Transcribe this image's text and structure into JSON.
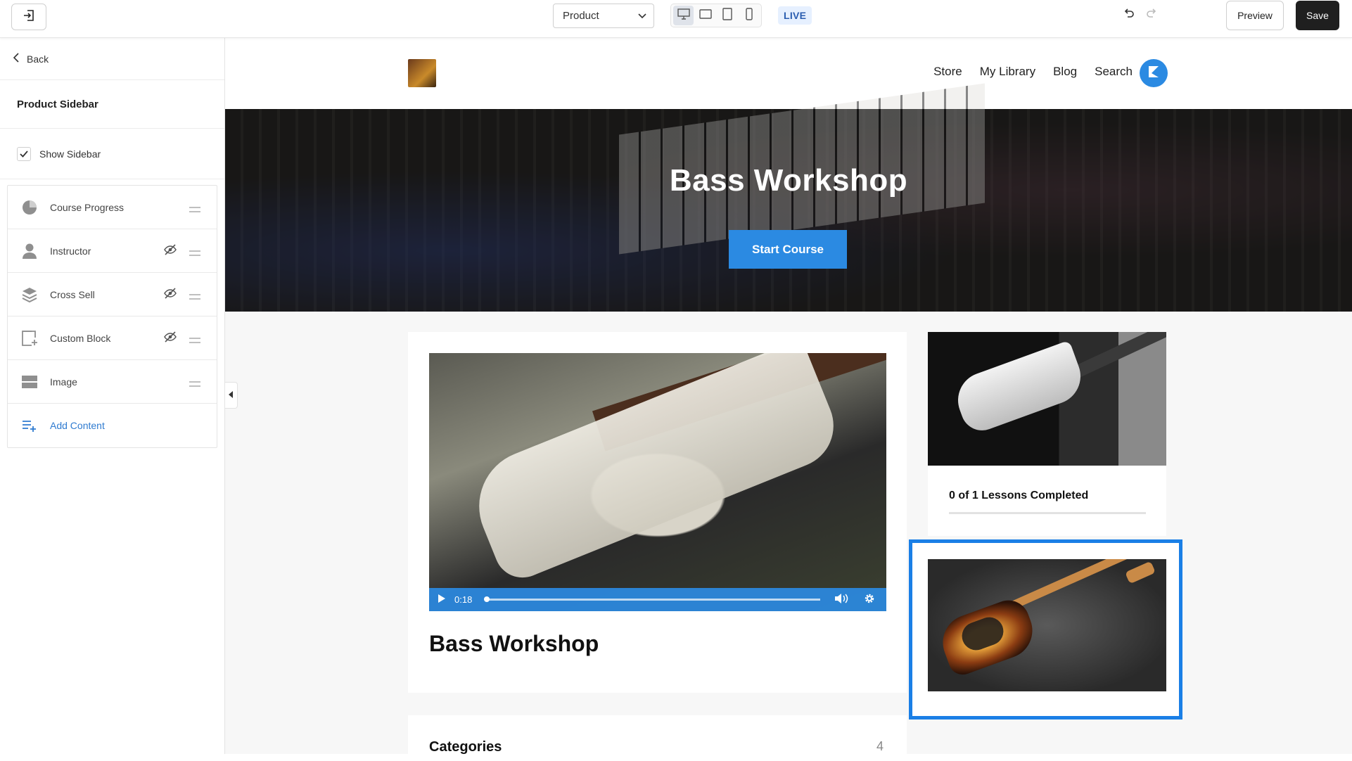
{
  "toolbar": {
    "page_select_value": "Product",
    "live_label": "LIVE",
    "preview_label": "Preview",
    "save_label": "Save"
  },
  "sidebar": {
    "back_label": "Back",
    "title": "Product Sidebar",
    "show_sidebar_label": "Show Sidebar",
    "show_sidebar_checked": true,
    "blocks": [
      {
        "label": "Course Progress",
        "icon": "pie-chart-icon",
        "hidden": false
      },
      {
        "label": "Instructor",
        "icon": "person-icon",
        "hidden": true
      },
      {
        "label": "Cross Sell",
        "icon": "layers-icon",
        "hidden": true
      },
      {
        "label": "Custom Block",
        "icon": "custom-block-icon",
        "hidden": true
      },
      {
        "label": "Image",
        "icon": "image-block-icon",
        "hidden": false
      }
    ],
    "add_content_label": "Add Content"
  },
  "site": {
    "nav": [
      "Store",
      "My Library",
      "Blog",
      "Search"
    ],
    "hero_title": "Bass Workshop",
    "hero_button": "Start Course",
    "video_time": "0:18",
    "product_title": "Bass Workshop",
    "progress_text": "0 of 1 Lessons Completed",
    "progress_fraction": 0,
    "categories_title": "Categories",
    "categories_count": "4"
  },
  "colors": {
    "accent": "#2b8ae2",
    "selection": "#1a7fe6",
    "save_button": "#1f1f1f"
  }
}
